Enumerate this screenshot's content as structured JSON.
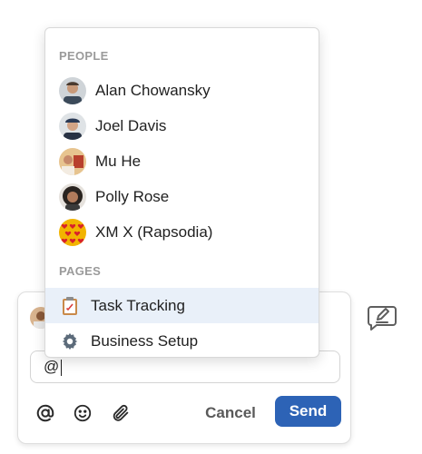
{
  "mention_menu": {
    "people_heading": "PEOPLE",
    "people": [
      {
        "name": "Alan Chowansky",
        "avatar": "person-avatar"
      },
      {
        "name": "Joel Davis",
        "avatar": "person-avatar"
      },
      {
        "name": "Mu He",
        "avatar": "person-avatar"
      },
      {
        "name": "Polly Rose",
        "avatar": "person-avatar"
      },
      {
        "name": "XM X (Rapsodia)",
        "avatar": "heart-pattern-avatar"
      }
    ],
    "pages_heading": "PAGES",
    "pages": [
      {
        "name": "Task Tracking",
        "icon": "clipboard-icon",
        "highlighted": true
      },
      {
        "name": "Business Setup",
        "icon": "gear-icon",
        "highlighted": false
      }
    ]
  },
  "composer": {
    "input_value": "@",
    "tools": [
      "at-mention-icon",
      "emoji-icon",
      "paperclip-icon"
    ],
    "cancel_label": "Cancel",
    "send_label": "Send"
  },
  "colors": {
    "send_button": "#2d63b6",
    "highlight_row": "#e9f0f9",
    "section_heading": "#9a9a9a"
  }
}
